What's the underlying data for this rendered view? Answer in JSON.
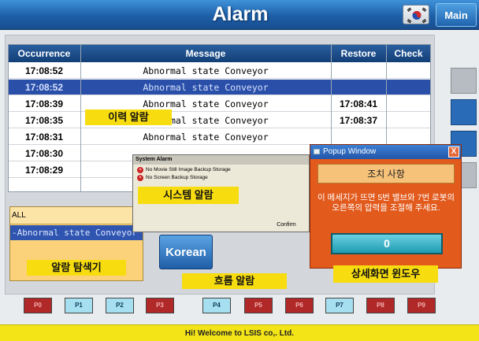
{
  "header": {
    "title": "Alarm",
    "main_label": "Main",
    "flag_icon": "korean-flag-icon"
  },
  "table": {
    "columns": [
      "Occurrence",
      "Message",
      "Restore",
      "Check"
    ],
    "rows": [
      {
        "occurrence": "17:08:52",
        "message": "Abnormal state Conveyor",
        "restore": "",
        "check": ""
      },
      {
        "occurrence": "17:08:52",
        "message": "Abnormal state Conveyor",
        "restore": "",
        "check": ""
      },
      {
        "occurrence": "17:08:39",
        "message": "Abnormal state Conveyor",
        "restore": "17:08:41",
        "check": ""
      },
      {
        "occurrence": "17:08:35",
        "message": "Abnormal state Conveyor",
        "restore": "17:08:37",
        "check": ""
      },
      {
        "occurrence": "17:08:31",
        "message": "Abnormal state Conveyor",
        "restore": "",
        "check": ""
      },
      {
        "occurrence": "17:08:30",
        "message": "",
        "restore": "",
        "check": ""
      },
      {
        "occurrence": "17:08:29",
        "message": "",
        "restore": "",
        "check": ""
      }
    ]
  },
  "labels": {
    "history": "이력 알람",
    "system": "시스템 알람",
    "search": "알람 탐색기",
    "flow": "흐름 알람",
    "detail": "상세화면 윈도우"
  },
  "system_alarm": {
    "title": "System Alarm",
    "items": [
      "No Movie Still Image Backup Storage",
      "No Screen Backup Storage"
    ],
    "confirm": "Confirm"
  },
  "filter": {
    "all": "ALL",
    "selected": "-Abnormal state Conveyor"
  },
  "korean_button": "Korean",
  "popup": {
    "title": "Popup Window",
    "close": "X",
    "header": "조치 사항",
    "message": "이 메세지가 뜨면 5번 밸브와 7번 로봇의 오른쪽의 압력을 조절해 주세요.",
    "value": "0"
  },
  "pipeline": [
    {
      "label": "P0",
      "state": "alarm"
    },
    {
      "label": "P1",
      "state": "normal"
    },
    {
      "label": "P2",
      "state": "normal"
    },
    {
      "label": "P3",
      "state": "alarm"
    },
    {
      "label": "P4",
      "state": "normal"
    },
    {
      "label": "P5",
      "state": "alarm"
    },
    {
      "label": "P6",
      "state": "alarm"
    },
    {
      "label": "P7",
      "state": "normal"
    },
    {
      "label": "P8",
      "state": "alarm"
    },
    {
      "label": "P9",
      "state": "alarm"
    }
  ],
  "footer": "Hi! Welcome to LSIS co,. Ltd.",
  "colors": {
    "header_blue": "#1d5fa8",
    "selected_row": "#2a4fa8",
    "highlight_yellow": "#f7dc10",
    "popup_orange": "#e25a1c",
    "alarm_red": "#b02828",
    "normal_cyan": "#a6dff0"
  }
}
